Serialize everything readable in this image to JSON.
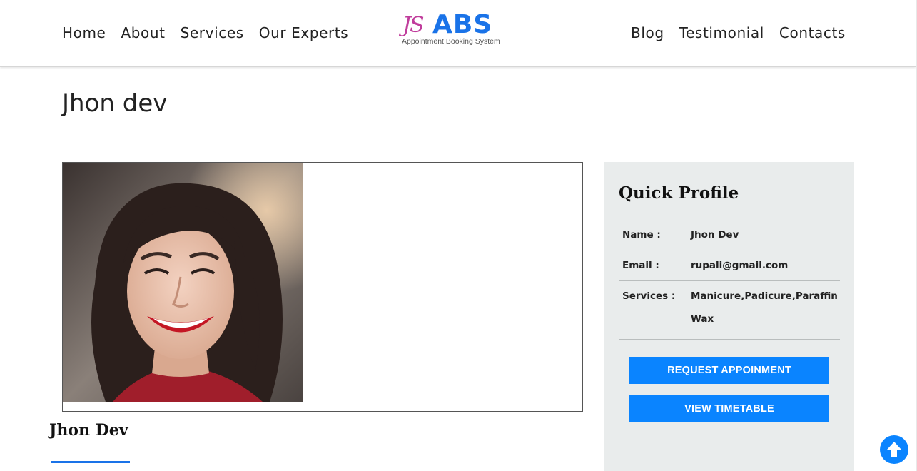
{
  "nav": {
    "left": [
      "Home",
      "About",
      "Services",
      "Our Experts"
    ],
    "right": [
      "Blog",
      "Testimonial",
      "Contacts"
    ]
  },
  "logo": {
    "mark": "JS",
    "name": "ABS",
    "tagline": "Appointment Booking System"
  },
  "page": {
    "title": "Jhon dev"
  },
  "expert": {
    "name": "Jhon Dev"
  },
  "profile": {
    "heading": "Quick Profile",
    "rows": [
      {
        "label": "Name :",
        "value": "Jhon Dev"
      },
      {
        "label": "Email :",
        "value": "rupali@gmail.com"
      },
      {
        "label": "Services :",
        "value": "Manicure,Padicure,Paraffin Wax"
      }
    ],
    "request_button": "REQUEST APPOINMENT",
    "timetable_button": "VIEW TIMETABLE"
  },
  "icons": {
    "scroll_top": "arrow-up-icon"
  },
  "colors": {
    "accent": "#0a84ff",
    "logo_blue": "#1a73e8",
    "logo_pink": "#c03d9c",
    "panel_bg": "#e9ecec"
  }
}
